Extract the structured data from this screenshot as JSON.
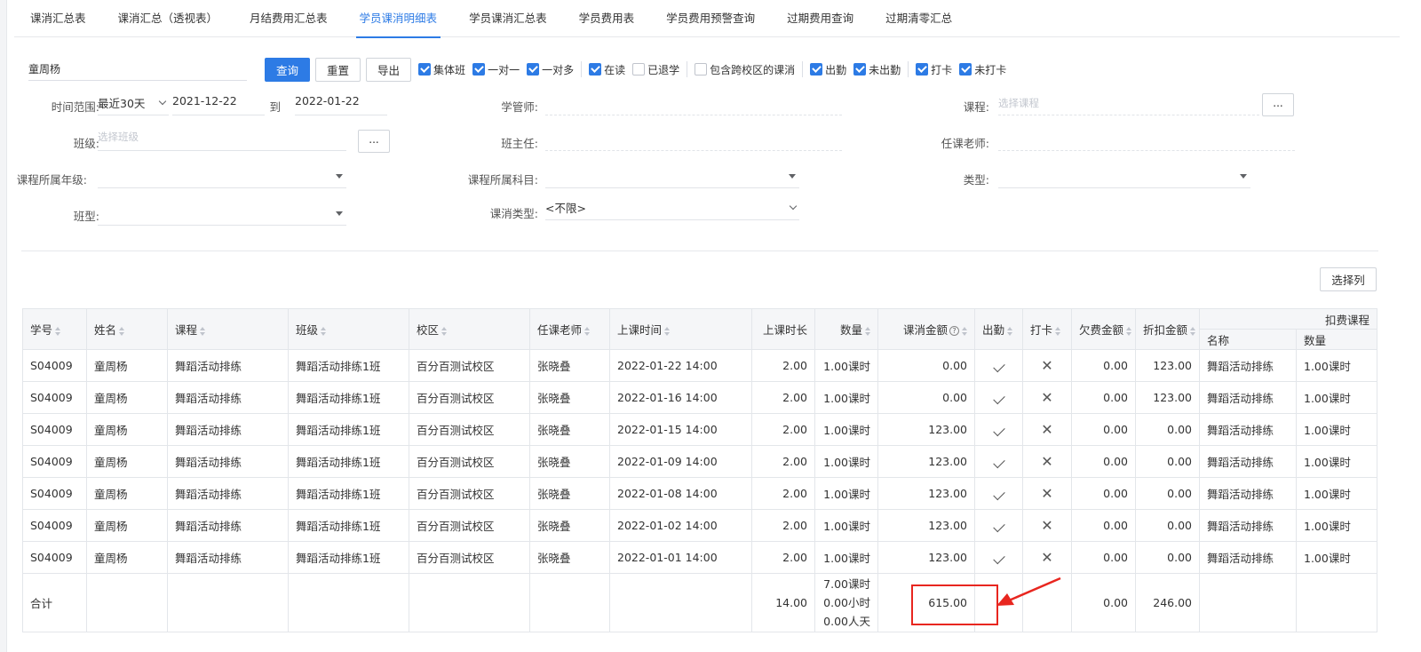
{
  "tabs": [
    "课消汇总表",
    "课消汇总（透视表）",
    "月结费用汇总表",
    "学员课消明细表",
    "学员课消汇总表",
    "学员费用表",
    "学员费用预警查询",
    "过期费用查询",
    "过期清零汇总"
  ],
  "active_tab_index": 3,
  "toolbar": {
    "name_value": "童周杨",
    "query_label": "查询",
    "reset_label": "重置",
    "export_label": "导出",
    "checkboxes": [
      {
        "label": "集体班",
        "checked": true
      },
      {
        "label": "一对一",
        "checked": true
      },
      {
        "label": "一对多",
        "checked": true
      },
      {
        "label": "在读",
        "checked": true
      },
      {
        "label": "已退学",
        "checked": false
      },
      {
        "label": "包含跨校区的课消",
        "checked": false
      },
      {
        "label": "出勤",
        "checked": true
      },
      {
        "label": "未出勤",
        "checked": true
      },
      {
        "label": "打卡",
        "checked": true
      },
      {
        "label": "未打卡",
        "checked": true
      }
    ]
  },
  "filters": {
    "time_label": "时间范围:",
    "time_range": "最近30天",
    "start_date": "2021-12-22",
    "to_label": "到",
    "end_date": "2022-01-22",
    "manager_label": "学管师:",
    "course_label": "课程:",
    "course_placeholder": "选择课程",
    "class_label": "班级:",
    "class_placeholder": "选择班级",
    "head_teacher_label": "班主任:",
    "teacher_label": "任课老师:",
    "grade_label": "课程所属年级:",
    "subject_label": "课程所属科目:",
    "type_label": "类型:",
    "class_type_label": "班型:",
    "consume_type_label": "课消类型:",
    "consume_type_value": "<不限>",
    "more_label": "..."
  },
  "select_columns_label": "选择列",
  "table": {
    "headers": {
      "id": "学号",
      "name": "姓名",
      "course": "课程",
      "class": "班级",
      "campus": "校区",
      "teacher": "任课老师",
      "time": "上课时间",
      "duration": "上课时长",
      "qty": "数量",
      "amount": "课消金额",
      "attend": "出勤",
      "checkin": "打卡",
      "owed": "欠费金额",
      "discount": "折扣金额",
      "deduct": "扣费课程",
      "deduct_name": "名称",
      "deduct_qty": "数量"
    },
    "rows": [
      {
        "id": "S04009",
        "name": "童周杨",
        "course": "舞蹈活动排练",
        "class": "舞蹈活动排练1班",
        "campus": "百分百测试校区",
        "teacher": "张晓叠",
        "time": "2022-01-22 14:00",
        "duration": "2.00",
        "qty": "1.00课时",
        "amount": "0.00",
        "owed": "0.00",
        "discount": "123.00",
        "deduct_name": "舞蹈活动排练",
        "deduct_qty": "1.00课时"
      },
      {
        "id": "S04009",
        "name": "童周杨",
        "course": "舞蹈活动排练",
        "class": "舞蹈活动排练1班",
        "campus": "百分百测试校区",
        "teacher": "张晓叠",
        "time": "2022-01-16 14:00",
        "duration": "2.00",
        "qty": "1.00课时",
        "amount": "0.00",
        "owed": "0.00",
        "discount": "123.00",
        "deduct_name": "舞蹈活动排练",
        "deduct_qty": "1.00课时"
      },
      {
        "id": "S04009",
        "name": "童周杨",
        "course": "舞蹈活动排练",
        "class": "舞蹈活动排练1班",
        "campus": "百分百测试校区",
        "teacher": "张晓叠",
        "time": "2022-01-15 14:00",
        "duration": "2.00",
        "qty": "1.00课时",
        "amount": "123.00",
        "owed": "0.00",
        "discount": "0.00",
        "deduct_name": "舞蹈活动排练",
        "deduct_qty": "1.00课时"
      },
      {
        "id": "S04009",
        "name": "童周杨",
        "course": "舞蹈活动排练",
        "class": "舞蹈活动排练1班",
        "campus": "百分百测试校区",
        "teacher": "张晓叠",
        "time": "2022-01-09 14:00",
        "duration": "2.00",
        "qty": "1.00课时",
        "amount": "123.00",
        "owed": "0.00",
        "discount": "0.00",
        "deduct_name": "舞蹈活动排练",
        "deduct_qty": "1.00课时"
      },
      {
        "id": "S04009",
        "name": "童周杨",
        "course": "舞蹈活动排练",
        "class": "舞蹈活动排练1班",
        "campus": "百分百测试校区",
        "teacher": "张晓叠",
        "time": "2022-01-08 14:00",
        "duration": "2.00",
        "qty": "1.00课时",
        "amount": "123.00",
        "owed": "0.00",
        "discount": "0.00",
        "deduct_name": "舞蹈活动排练",
        "deduct_qty": "1.00课时"
      },
      {
        "id": "S04009",
        "name": "童周杨",
        "course": "舞蹈活动排练",
        "class": "舞蹈活动排练1班",
        "campus": "百分百测试校区",
        "teacher": "张晓叠",
        "time": "2022-01-02 14:00",
        "duration": "2.00",
        "qty": "1.00课时",
        "amount": "123.00",
        "owed": "0.00",
        "discount": "0.00",
        "deduct_name": "舞蹈活动排练",
        "deduct_qty": "1.00课时"
      },
      {
        "id": "S04009",
        "name": "童周杨",
        "course": "舞蹈活动排练",
        "class": "舞蹈活动排练1班",
        "campus": "百分百测试校区",
        "teacher": "张晓叠",
        "time": "2022-01-01 14:00",
        "duration": "2.00",
        "qty": "1.00课时",
        "amount": "123.00",
        "owed": "0.00",
        "discount": "0.00",
        "deduct_name": "舞蹈活动排练",
        "deduct_qty": "1.00课时"
      }
    ],
    "total": {
      "label": "合计",
      "duration": "14.00",
      "qty_lines": [
        "7.00课时",
        "0.00小时",
        "0.00人天"
      ],
      "amount": "615.00",
      "owed": "0.00",
      "discount": "246.00"
    }
  },
  "annotation_color": "#e8261f"
}
